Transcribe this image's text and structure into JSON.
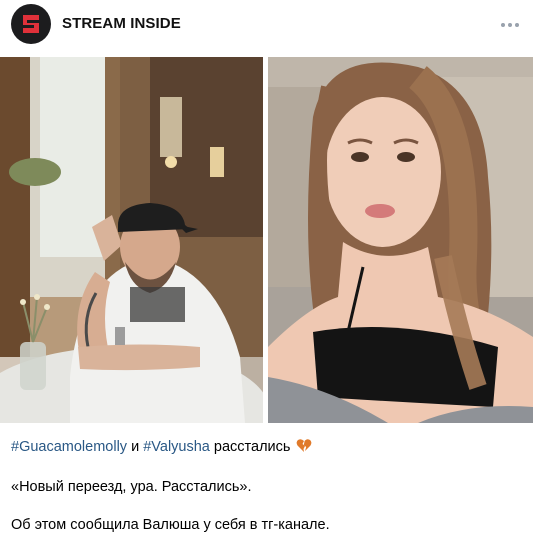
{
  "channel": {
    "name": "STREAM INSIDE",
    "avatar_icon": "stream-inside-logo",
    "brand_color": "#e0313a"
  },
  "header": {
    "more_icon": "three-dots-horizontal-icon"
  },
  "photos": [
    {
      "name": "photo-man-in-cap"
    },
    {
      "name": "photo-woman-selfie"
    }
  ],
  "post": {
    "hashtag1": "#Guacamolemolly",
    "conj": " и ",
    "hashtag2": "#Valyusha",
    "rest": " расстались ",
    "emoji_icon": "broken-heart-icon",
    "quote": "«Новый переезд, ура. Расстались».",
    "source_text": "Об этом сообщила Валюша у себя в тг-канале."
  },
  "colors": {
    "hashtag": "#2a5885",
    "broken_heart": "#e07a2a"
  }
}
